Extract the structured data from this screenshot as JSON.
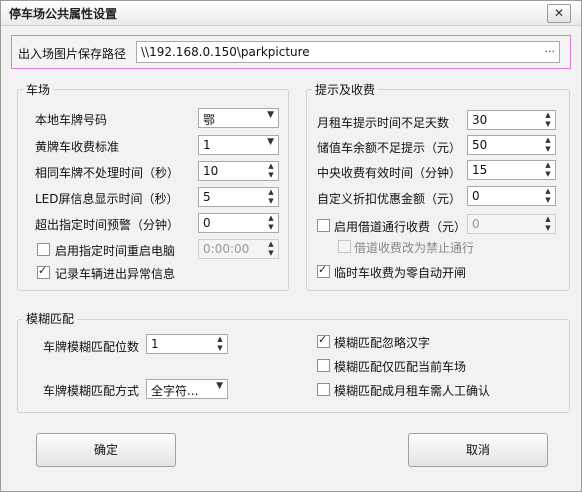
{
  "window": {
    "title": "停车场公共属性设置",
    "close_label": "✕"
  },
  "path": {
    "label": "出入场图片保存路径",
    "value": "\\\\192.168.0.150\\parkpicture",
    "browse_label": "···"
  },
  "parking": {
    "title": "车场",
    "plate_prefix": {
      "label": "本地车牌号码",
      "value": "鄂"
    },
    "yellow_fee": {
      "label": "黄牌车收费标准",
      "value": "1"
    },
    "same_plate_ignore": {
      "label": "相同车牌不处理时间（秒）",
      "value": "10"
    },
    "led_time": {
      "label": "LED屏信息显示时间（秒）",
      "value": "5"
    },
    "overtime_warn": {
      "label": "超出指定时间预警（分钟）",
      "value": "0"
    },
    "restart": {
      "label": "启用指定时间重启电脑",
      "value": "0:00:00"
    },
    "record_abnormal": {
      "label": "记录车辆进出异常信息"
    }
  },
  "reminder": {
    "title": "提示及收费",
    "monthly_days": {
      "label": "月租车提示时间不足天数",
      "value": "30"
    },
    "balance": {
      "label": "储值车余额不足提示（元）",
      "value": "50"
    },
    "central_valid": {
      "label": "中央收费有效时间（分钟）",
      "value": "15"
    },
    "custom_discount": {
      "label": "自定义折扣优惠金额（元）",
      "value": "0"
    },
    "lane_fee": {
      "label": "启用借道通行收费（元）",
      "value": "0"
    },
    "lane_forbid": {
      "label": "借道收费改为禁止通行"
    },
    "temp_zero_open": {
      "label": "临时车收费为零自动开闸"
    }
  },
  "fuzzy": {
    "title": "模糊匹配",
    "digits": {
      "label": "车牌模糊匹配位数",
      "value": "1"
    },
    "mode": {
      "label": "车牌模糊匹配方式",
      "value": "全字符..."
    },
    "ignore_chinese": {
      "label": "模糊匹配忽略汉字"
    },
    "current_lot": {
      "label": "模糊匹配仅匹配当前车场"
    },
    "monthly_confirm": {
      "label": "模糊匹配成月租车需人工确认"
    }
  },
  "buttons": {
    "ok": "确定",
    "cancel": "取消"
  }
}
